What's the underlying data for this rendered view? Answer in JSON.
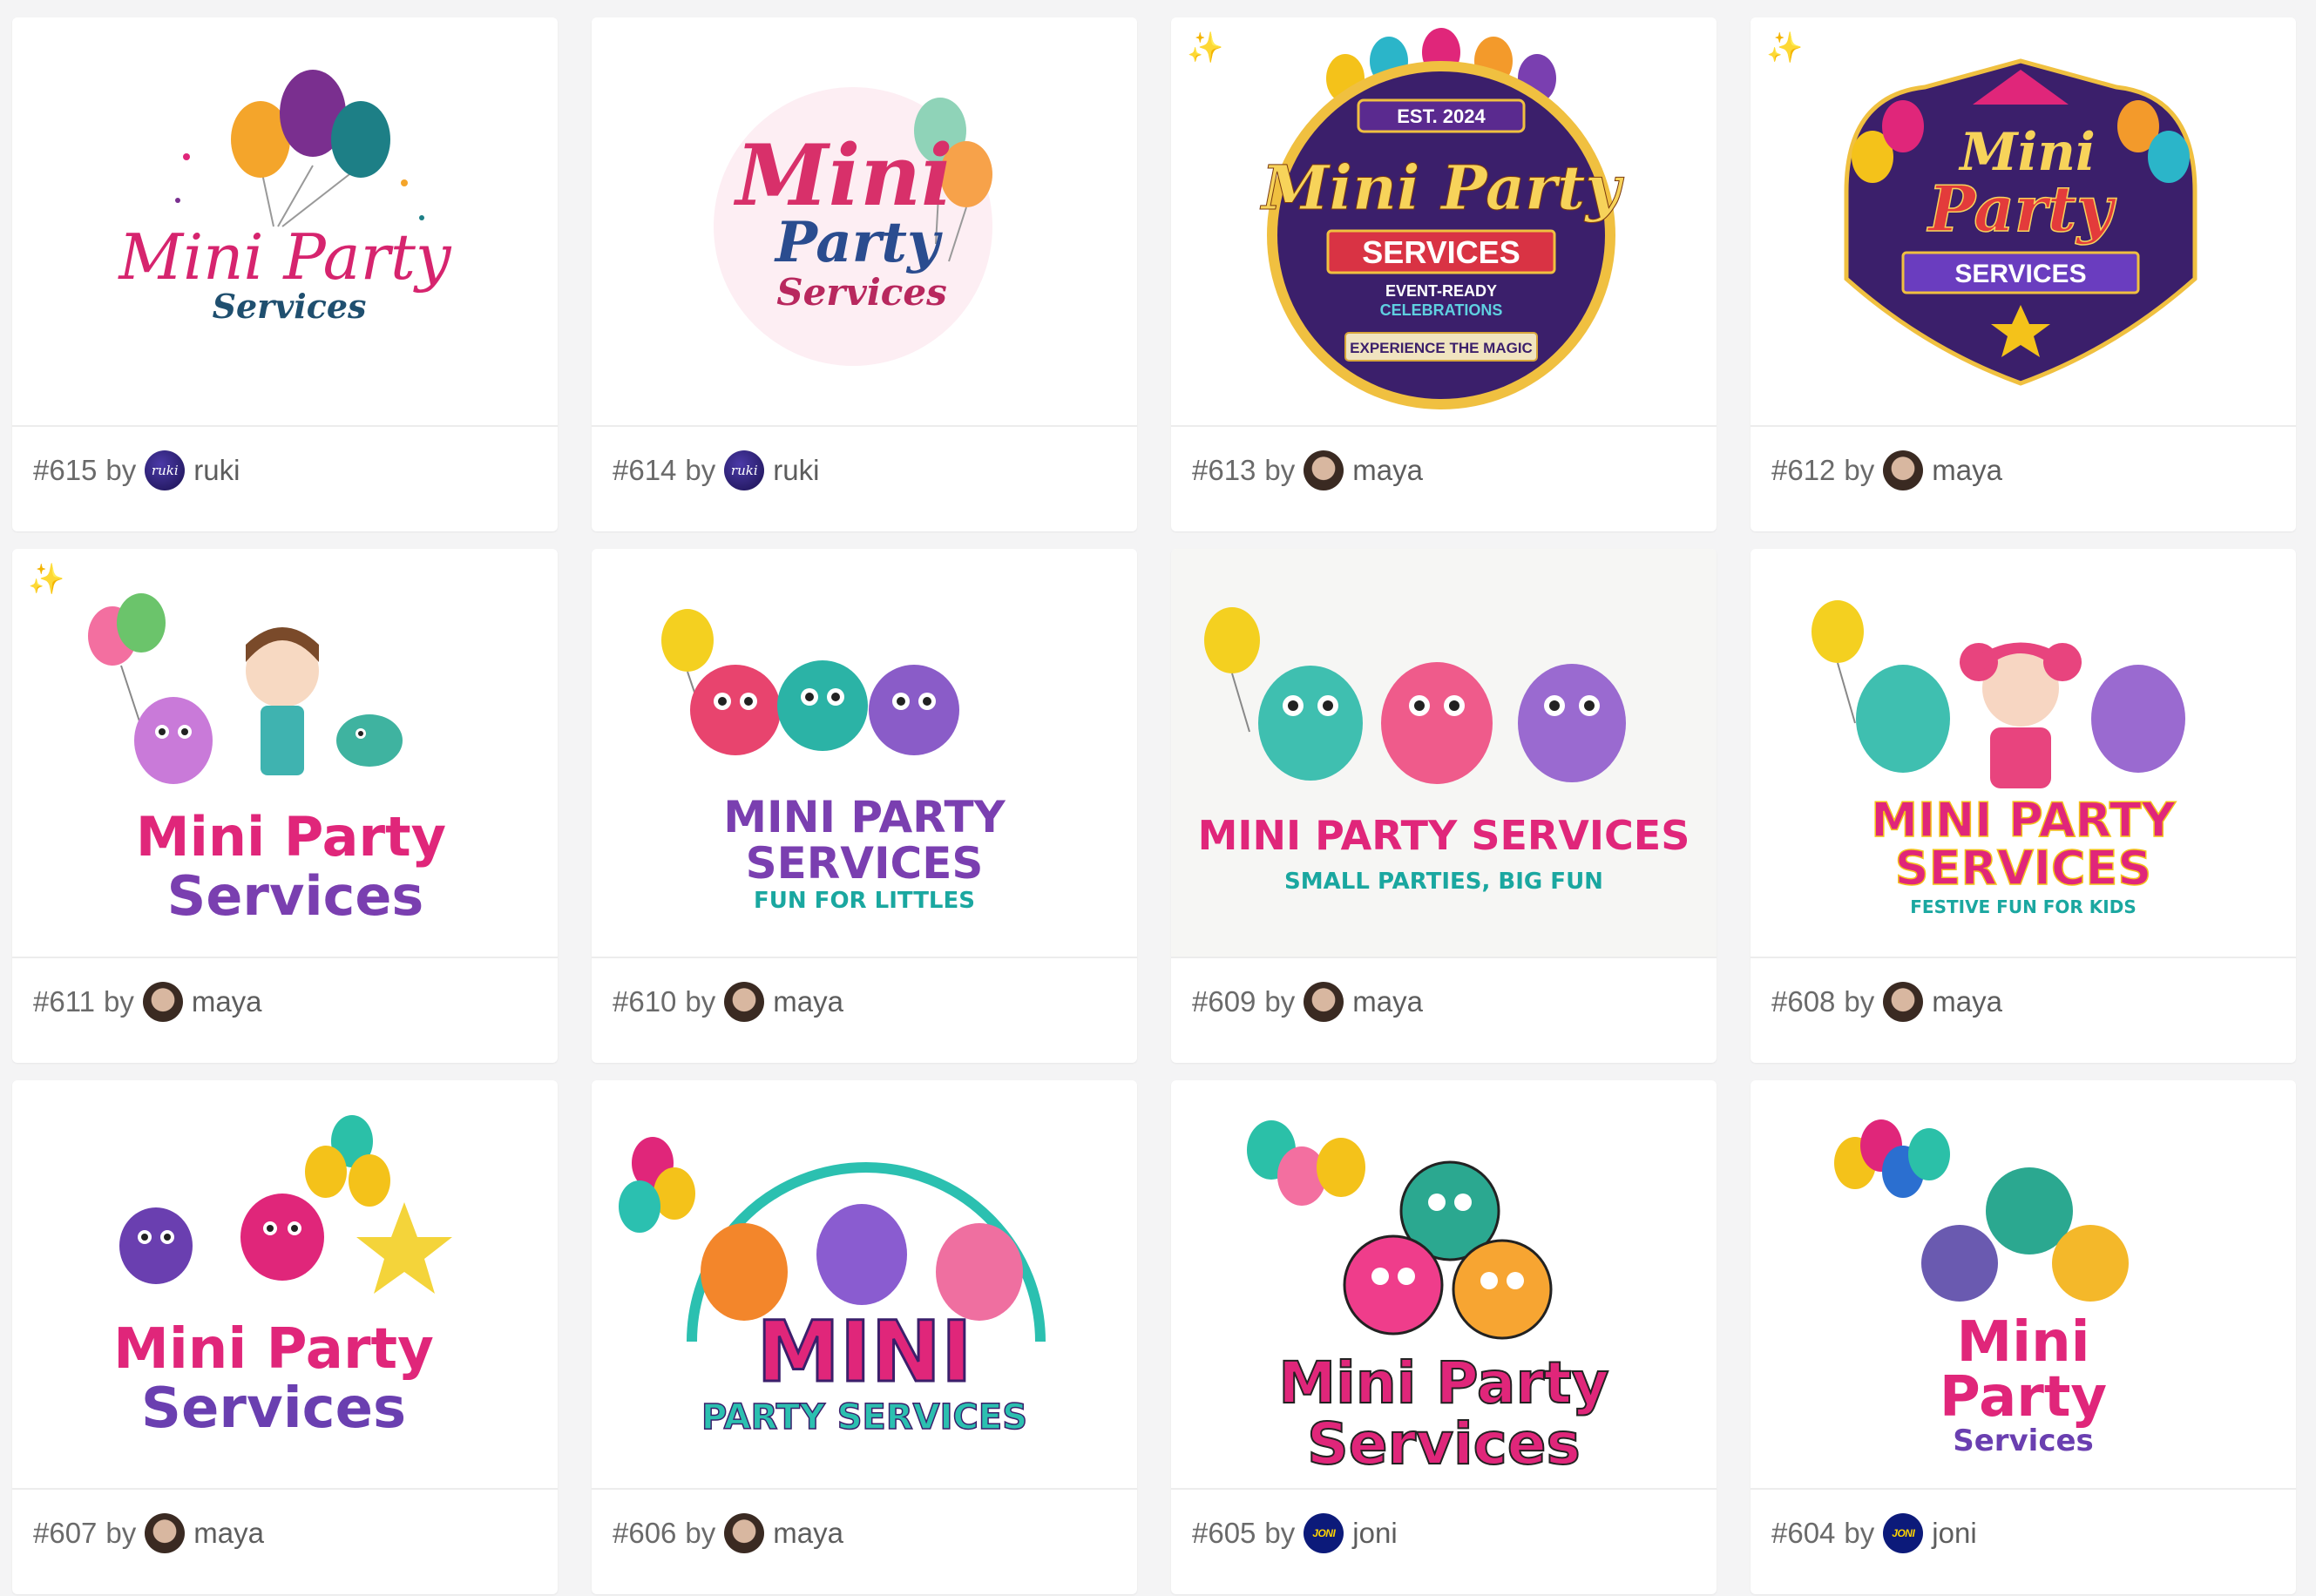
{
  "by_label": "by",
  "sparkle_glyph": "✨",
  "cards": [
    {
      "number": "#615",
      "author": "ruki",
      "avatar_text": "ruki",
      "logo": {
        "lines": [
          "Mini Party",
          "Services"
        ]
      }
    },
    {
      "number": "#614",
      "author": "ruki",
      "avatar_text": "ruki",
      "logo": {
        "lines": [
          "Mini",
          "Party",
          "Services"
        ]
      }
    },
    {
      "number": "#613",
      "author": "maya",
      "avatar_text": "",
      "logo": {
        "lines": [
          "EST. 2024",
          "Mini Party",
          "SERVICES",
          "EVENT-READY",
          "CELEBRATIONS",
          "EXPERIENCE THE MAGIC"
        ]
      }
    },
    {
      "number": "#612",
      "author": "maya",
      "avatar_text": "",
      "logo": {
        "lines": [
          "Mini",
          "Party",
          "SERVICES"
        ]
      }
    },
    {
      "number": "#611",
      "author": "maya",
      "avatar_text": "",
      "logo": {
        "lines": [
          "Mini Party",
          "Services"
        ]
      }
    },
    {
      "number": "#610",
      "author": "maya",
      "avatar_text": "",
      "logo": {
        "lines": [
          "MINI PARTY",
          "SERVICES",
          "FUN FOR LITTLES"
        ]
      }
    },
    {
      "number": "#609",
      "author": "maya",
      "avatar_text": "",
      "logo": {
        "lines": [
          "MINI PARTY SERVICES",
          "SMALL PARTIES, BIG FUN"
        ]
      }
    },
    {
      "number": "#608",
      "author": "maya",
      "avatar_text": "",
      "logo": {
        "lines": [
          "MINI PARTY",
          "SERVICES",
          "FESTIVE FUN FOR KIDS"
        ]
      }
    },
    {
      "number": "#607",
      "author": "maya",
      "avatar_text": "",
      "logo": {
        "lines": [
          "Mini Party",
          "Services"
        ]
      }
    },
    {
      "number": "#606",
      "author": "maya",
      "avatar_text": "",
      "logo": {
        "lines": [
          "MINI",
          "PARTY SERVICES"
        ]
      }
    },
    {
      "number": "#605",
      "author": "joni",
      "avatar_text": "JONI",
      "logo": {
        "lines": [
          "Mini Party",
          "Services"
        ]
      }
    },
    {
      "number": "#604",
      "author": "joni",
      "avatar_text": "JONI",
      "logo": {
        "lines": [
          "Mini",
          "Party",
          "Services"
        ]
      }
    }
  ],
  "colors": {
    "page_bg": "#f4f4f5",
    "card_bg": "#ffffff",
    "pink": "#e0267a",
    "teal": "#1aa7a0",
    "purple": "#7a3fb0",
    "navy": "#1f3f6f",
    "yellow": "#f4c21a",
    "orange": "#f39a2b",
    "badge_purple": "#3b1f6b",
    "red": "#e23b3b"
  }
}
